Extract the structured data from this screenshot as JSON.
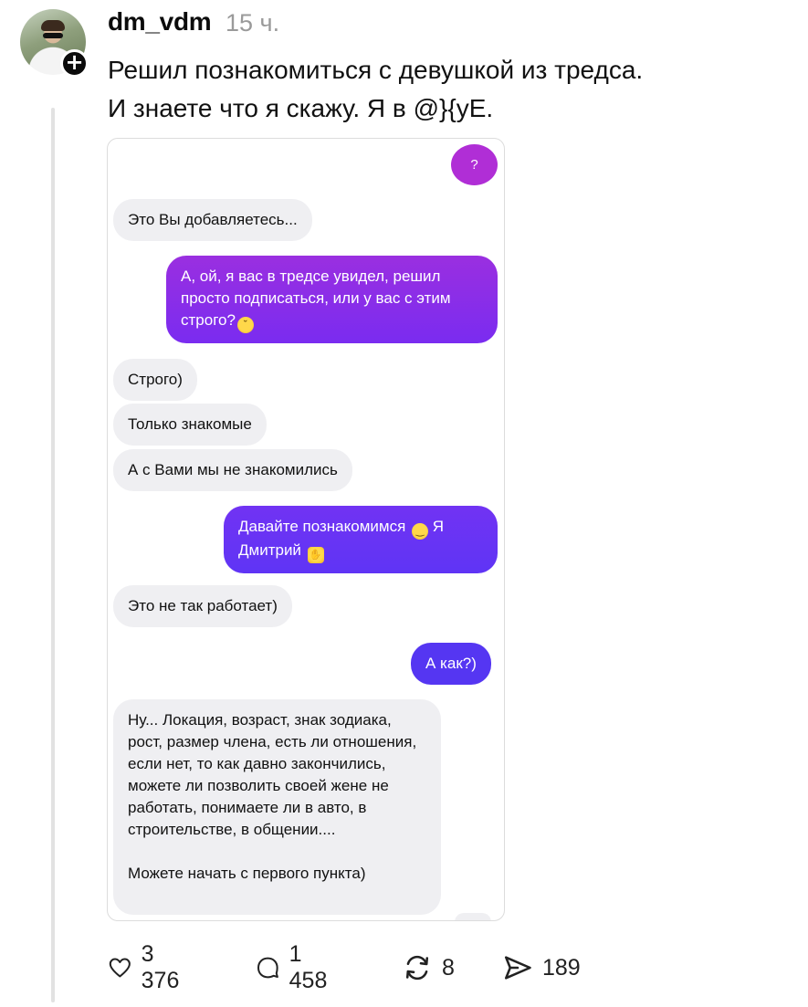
{
  "post": {
    "username": "dm_vdm",
    "time": "15 ч.",
    "caption_line1": "Решил познакомиться с девушкой из тредса.",
    "caption_line2": "И знаете что я скажу. Я в @}{уЕ."
  },
  "chat": {
    "msg_q": "?",
    "msg1": "Это Вы добавляетесь...",
    "msg2": "А, ой, я вас в тредсе увидел, решил просто подписаться, или у вас с этим строго?",
    "msg3": "Строго)",
    "msg4": "Только знакомые",
    "msg5": "А с Вами мы не знакомились",
    "msg6_a": "Давайте познакомимся",
    "msg6_b": "Я Дмитрий",
    "msg7": "Это не так работает)",
    "msg8": "А как?)",
    "msg9_a": "Ну... Локация, возраст, знак зодиака, рост, размер члена, есть ли отношения, если нет, то как давно закончились, можете ли позволить своей жене не работать, понимаете ли в авто, в строительстве, в общении....",
    "msg9_b": "Можете начать с первого пункта)"
  },
  "actions": {
    "likes": "3 376",
    "comments": "1 458",
    "reposts": "8",
    "shares": "189"
  },
  "colors": {
    "outgoing_start": "#9a2fe0",
    "outgoing_end": "#5536f2",
    "incoming_bg": "#efeff2",
    "muted_text": "#9a9a9a"
  },
  "icons": [
    "heart-icon",
    "comment-icon",
    "repost-icon",
    "share-icon",
    "plus-icon"
  ]
}
